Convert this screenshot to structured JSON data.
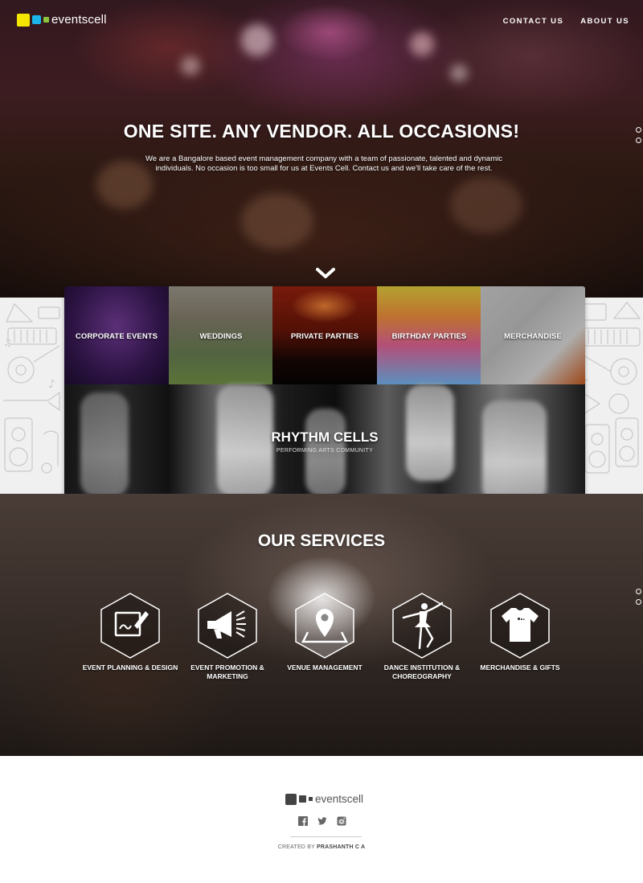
{
  "brand": {
    "name": "eventscell",
    "colors": {
      "yellow": "#f5e600",
      "blue": "#1ab4e8",
      "green": "#8bc53f"
    }
  },
  "nav": {
    "items": [
      "CONTACT US",
      "ABOUT US"
    ]
  },
  "hero": {
    "title": "ONE SITE. ANY VENDOR. ALL OCCASIONS!",
    "description": "We are a Bangalore based event management company with a team of passionate, talented and dynamic individuals. No occasion is too small for us at Events Cell. Contact us and we'll take care of the rest.",
    "scroll_icon": "chevron-down-icon"
  },
  "categories": [
    {
      "label": "CORPORATE EVENTS"
    },
    {
      "label": "WEDDINGS"
    },
    {
      "label": "PRIVATE PARTIES"
    },
    {
      "label": "BIRTHDAY PARTIES"
    },
    {
      "label": "MERCHANDISE"
    }
  ],
  "feature": {
    "title": "RHYTHM CELLS",
    "subtitle": "PERFORMING ARTS COMMUNITY"
  },
  "services": {
    "title": "OUR SERVICES",
    "items": [
      {
        "label": "EVENT PLANNING & DESIGN",
        "icon": "pen-board-icon"
      },
      {
        "label": "EVENT PROMOTION & MARKETING",
        "icon": "megaphone-icon"
      },
      {
        "label": "VENUE MANAGEMENT",
        "icon": "map-pin-icon"
      },
      {
        "label": "DANCE INSTITUTION & CHOREOGRAPHY",
        "icon": "ballerina-icon"
      },
      {
        "label": "MERCHANDISE & GIFTS",
        "icon": "t-shirt-icon"
      }
    ]
  },
  "footer": {
    "brand": "eventscell",
    "social": [
      "facebook-icon",
      "twitter-icon",
      "instagram-icon"
    ],
    "credit_prefix": "CREATED BY",
    "credit_name": "PRASHANTH C A"
  }
}
